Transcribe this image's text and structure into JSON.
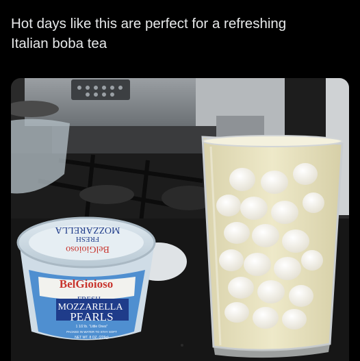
{
  "post": {
    "caption_line1": "Hot days like this are perfect for a refreshing",
    "caption_line2": "Italian boba tea"
  },
  "photo": {
    "container_top_brand": "BelGioioso",
    "container_top_text1": "FRESH",
    "container_top_text2": "MOZZARELLA",
    "brand": "BelGioioso",
    "line_fresh": "FRESH",
    "line_mozzarella": "MOZZARELLA",
    "line_pearls": "PEARLS",
    "line_little_ones": "1 1/2 lb. \"Little Ones\"",
    "line_packed": "PACKED IN WATER TO STAY SOFT",
    "line_net_wt": "NET WT. 8 OZ. (226g)",
    "colors": {
      "label_blue": "#4f8fd0",
      "brand_red": "#c8352e",
      "drink": "#e8e2bf",
      "counter": "#161616"
    }
  }
}
